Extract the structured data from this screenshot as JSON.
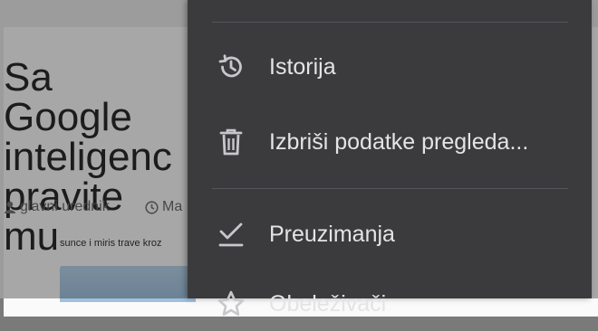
{
  "article": {
    "title": "Sa Google\ninteligenc\npravite mu",
    "author": "glavni urednik",
    "date": "Ma",
    "caption": "sunce i miris trave kroz"
  },
  "menu": {
    "items": [
      {
        "label": "Istorija",
        "icon": "history-icon"
      },
      {
        "label": "Izbriši podatke pregleda...",
        "icon": "trash-icon"
      },
      {
        "label": "Preuzimanja",
        "icon": "download-check-icon"
      },
      {
        "label": "Obeleživači",
        "icon": "star-icon"
      }
    ]
  },
  "colors": {
    "menu_bg": "#3b3b3e",
    "menu_text": "#e4e4e6",
    "icon": "#c8c8cc"
  }
}
